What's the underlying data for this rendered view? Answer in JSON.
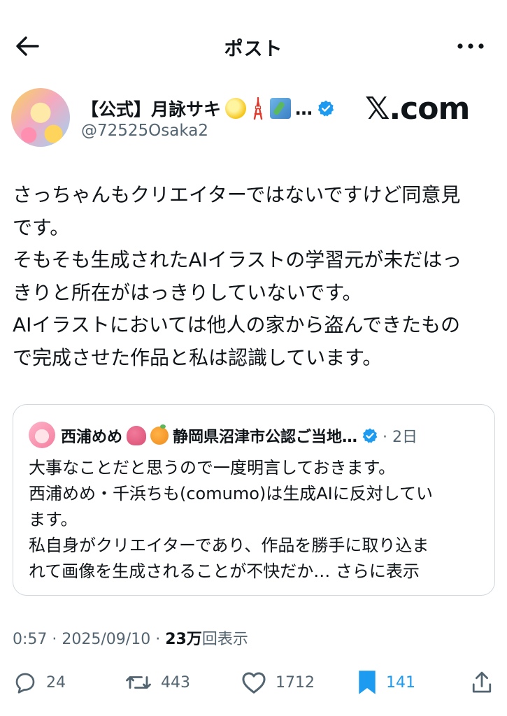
{
  "header": {
    "title": "ポスト"
  },
  "author": {
    "display_name": "【公式】月詠サキ",
    "handle": "@72525Osaka2",
    "ellipsis": "…",
    "verified": true
  },
  "watermark": "𝕏.com",
  "post": {
    "lines": [
      "さっちゃんもクリエイターではないですけど同意見",
      "です。",
      "そもそも生成されたAIイラストの学習元が未だはっ",
      "きりと所在がはっきりしていないです。",
      "AIイラストにおいては他人の家から盗んできたもの",
      "で完成させた作品と私は認識しています。"
    ]
  },
  "quote": {
    "name": "西浦めめ",
    "name2": "静岡県沼津市公認ご当地…",
    "time": "· 2日",
    "lines": [
      "大事なことだと思うので一度明言しておきます。",
      "西浦めめ・千浜ちも(comumo)は生成AIに反対してい",
      "ます。",
      "私自身がクリエイターであり、作品を勝手に取り込ま"
    ],
    "last_line": "れて画像を生成されることが不快だか… ",
    "show_more": "さらに表示"
  },
  "meta": {
    "time": "0:57",
    "date": "2025/09/10",
    "views_count": "23万",
    "views_label": "回表示"
  },
  "actions": {
    "replies": "24",
    "reposts": "443",
    "likes": "1712",
    "bookmarks": "141"
  },
  "colors": {
    "text": "#0f1419",
    "secondary": "#536471",
    "accent": "#1d9bf0",
    "border": "#cfd9de"
  },
  "icons": {
    "back": "arrow-left-icon",
    "more": "more-horizontal-icon",
    "verified": "verified-badge-icon",
    "reply": "comment-icon",
    "repost": "repost-icon",
    "like": "heart-icon",
    "bookmark": "bookmark-filled-icon",
    "share": "share-icon"
  }
}
